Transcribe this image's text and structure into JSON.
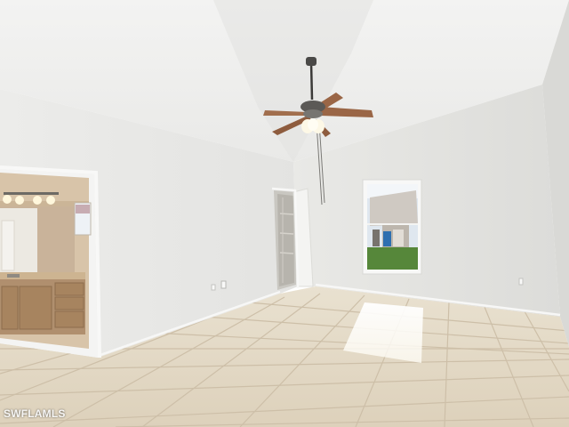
{
  "photo": {
    "subject": "empty-bedroom",
    "features": [
      "vaulted-ceiling",
      "ceiling-fan",
      "tile-floor",
      "window",
      "open-closet-door",
      "ensuite-bathroom-vanity"
    ]
  },
  "watermark": {
    "text": "SWFLAMLS"
  },
  "colors": {
    "ceiling": "#f1f1f0",
    "left_wall": "#ebebe9",
    "right_wall": "#e6e6e3",
    "tile_floor": "#e4dac8",
    "grout": "#cdbfa8",
    "fan_blades": "#9a6646",
    "cabinetry": "#b08f6e",
    "bath_wall": "#d7c3a9",
    "lawn": "#56873a"
  }
}
